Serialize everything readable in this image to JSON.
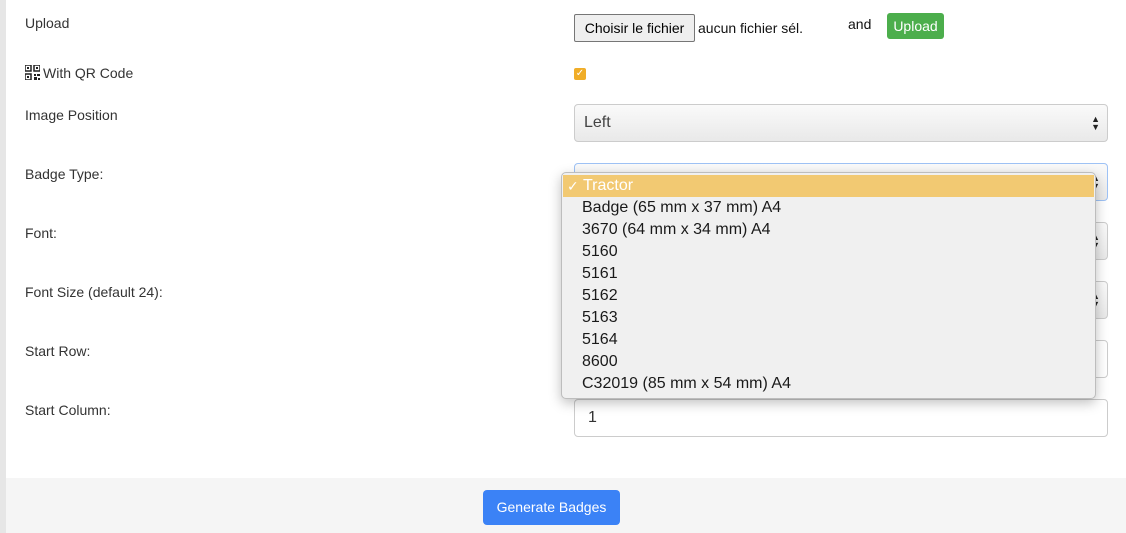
{
  "upload": {
    "label": "Upload",
    "file_button": "Choisir le fichier",
    "file_status": "aucun fichier sél.",
    "and_text": "and",
    "upload_button": "Upload"
  },
  "qr_code": {
    "label": "With QR Code",
    "icon": "qr-code-icon",
    "checked": true
  },
  "image_position": {
    "label": "Image Position",
    "value": "Left"
  },
  "badge_type": {
    "label": "Badge Type:",
    "options": [
      "Tractor",
      "Badge (65 mm x 37 mm) A4",
      "3670 (64 mm x 34 mm) A4",
      "5160",
      "5161",
      "5162",
      "5163",
      "5164",
      "8600",
      "C32019 (85 mm x 54 mm) A4"
    ],
    "selected_index": 0
  },
  "font": {
    "label": "Font:"
  },
  "font_size": {
    "label": "Font Size (default 24):"
  },
  "start_row": {
    "label": "Start Row:"
  },
  "start_column": {
    "label": "Start Column:",
    "value": "1"
  },
  "generate_button": "Generate Badges",
  "colors": {
    "upload_green": "#4cae4c",
    "checkbox_orange": "#f0ad28",
    "highlight": "#f2c972",
    "primary_blue": "#3b82f6"
  }
}
